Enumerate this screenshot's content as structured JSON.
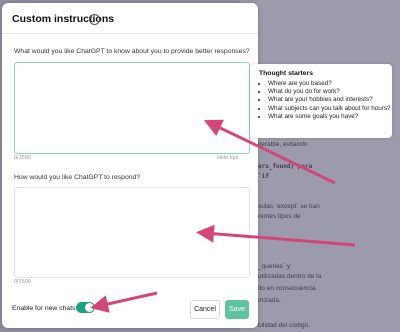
{
  "background": {
    "lines": [
      "iterable, evitando",
      "ors_found} para",
      "`if",
      "sulas `except` se han",
      "rentes tipos de",
      "_queries` y",
      "utilizadas dentro de la",
      "ito en consecuencia.",
      "mizada.",
      "bilidad del código."
    ]
  },
  "modal": {
    "title": "Custom instructions",
    "info_icon": "info-icon",
    "question_1": "What would you like ChatGPT to know about you to provide better responses?",
    "answer_1_value": "",
    "counter_1": "0/1500",
    "hide_tips": "Hide tips",
    "question_2": "How would you like ChatGPT to respond?",
    "answer_2_value": "",
    "counter_2": "0/1500",
    "toggle_label": "Enable for new chats",
    "toggle_on": true,
    "cancel_label": "Cancel",
    "save_label": "Save"
  },
  "thought_starters": {
    "title": "Thought starters",
    "items": [
      "Where are you based?",
      "What do you do for work?",
      "What are your hobbies and interests?",
      "What subjects can you talk about for hours?",
      "What are some goals you have?"
    ]
  },
  "colors": {
    "accent": "#19a37f",
    "save_button": "#5ec49f",
    "arrow": "#d6457a"
  }
}
